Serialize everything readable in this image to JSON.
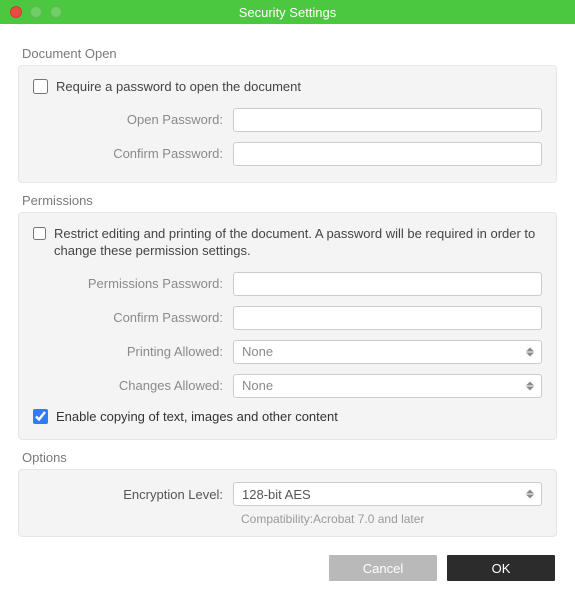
{
  "window": {
    "title": "Security Settings"
  },
  "document_open": {
    "section_label": "Document Open",
    "require_password_label": "Require a password to open the document",
    "require_password_checked": false,
    "open_password_label": "Open Password:",
    "open_password_value": "",
    "confirm_password_label": "Confirm Password:",
    "confirm_password_value": ""
  },
  "permissions": {
    "section_label": "Permissions",
    "restrict_label": "Restrict editing and printing of the document. A password will be required in order to change these permission settings.",
    "restrict_checked": false,
    "permissions_password_label": "Permissions Password:",
    "permissions_password_value": "",
    "confirm_password_label": "Confirm Password:",
    "confirm_password_value": "",
    "printing_allowed_label": "Printing Allowed:",
    "printing_allowed_value": "None",
    "changes_allowed_label": "Changes Allowed:",
    "changes_allowed_value": "None",
    "enable_copy_label": "Enable copying of text, images and other content",
    "enable_copy_checked": true
  },
  "options": {
    "section_label": "Options",
    "encryption_level_label": "Encryption Level:",
    "encryption_level_value": "128-bit AES",
    "compatibility_text": "Compatibility:Acrobat 7.0 and later"
  },
  "buttons": {
    "cancel": "Cancel",
    "ok": "OK"
  }
}
